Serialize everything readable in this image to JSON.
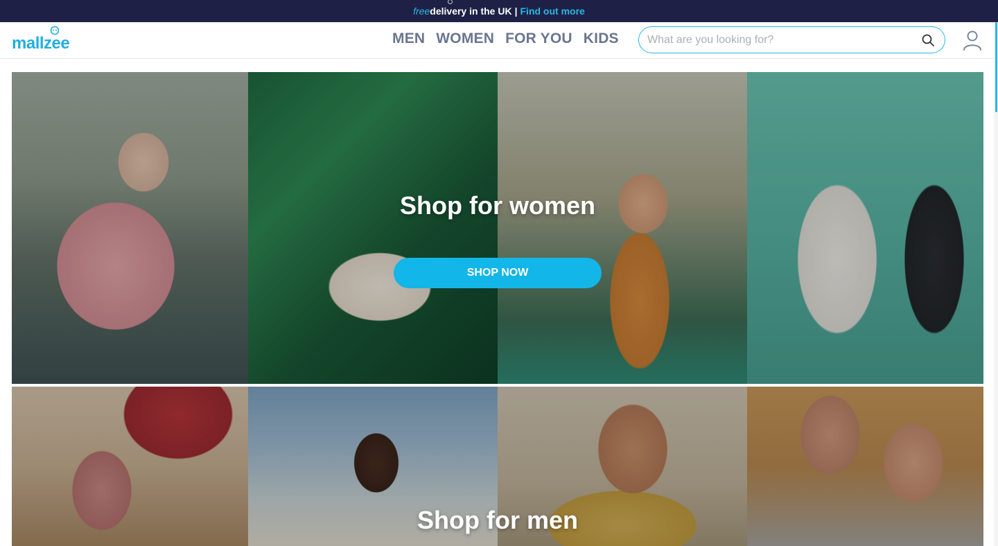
{
  "promo": {
    "free": "free",
    "delivery": "delivery",
    "rest": "in the UK",
    "separator": "|",
    "link": "Find out more"
  },
  "header": {
    "logo": "mallzee",
    "nav": [
      "MEN",
      "WOMEN",
      "FOR YOU",
      "KIDS"
    ],
    "search_placeholder": "What are you looking for?"
  },
  "banners": {
    "women": {
      "title": "Shop for women",
      "button": "SHOP NOW"
    },
    "men": {
      "title": "Shop for men"
    }
  },
  "colors": {
    "accent": "#27b8e6",
    "promo_bg": "#1e2145",
    "nav_text": "#6a7590",
    "button_bg": "#12b6e8"
  },
  "icons": [
    "logo-mark-icon",
    "search-icon",
    "user-icon"
  ]
}
